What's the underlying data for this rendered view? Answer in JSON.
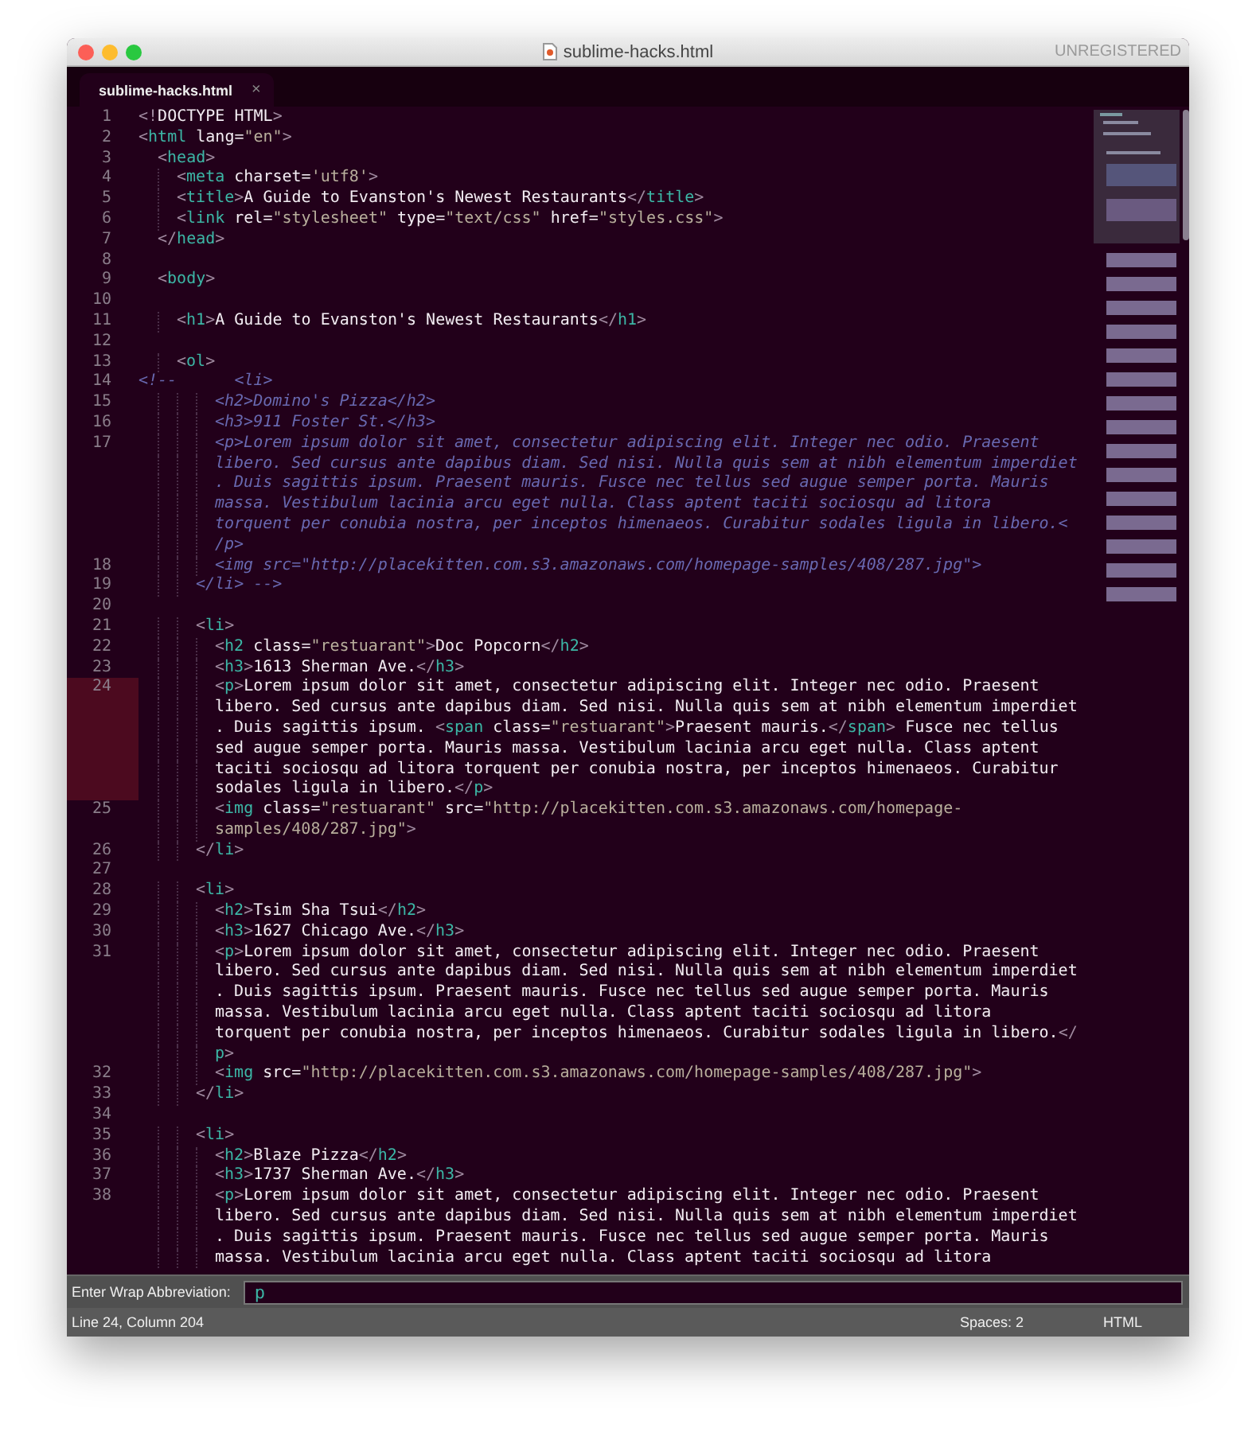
{
  "window": {
    "title": "sublime-hacks.html",
    "badge": "UNREGISTERED"
  },
  "tab": {
    "label": "sublime-hacks.html",
    "close": "×"
  },
  "lines": [
    {
      "number": "1",
      "kind": "code",
      "current": false,
      "rows": [
        "<!DOCTYPE HTML>"
      ]
    },
    {
      "number": "2",
      "kind": "code",
      "current": false,
      "rows": [
        "<html lang=\"en\">"
      ]
    },
    {
      "number": "3",
      "kind": "code",
      "current": false,
      "rows": [
        "  <head>"
      ]
    },
    {
      "number": "4",
      "kind": "code",
      "current": false,
      "rows": [
        "    <meta charset='utf8'>"
      ]
    },
    {
      "number": "5",
      "kind": "code",
      "current": false,
      "rows": [
        "    <title>A Guide to Evanston's Newest Restaurants</title>"
      ]
    },
    {
      "number": "6",
      "kind": "code",
      "current": false,
      "rows": [
        "    <link rel=\"stylesheet\" type=\"text/css\" href=\"styles.css\">"
      ]
    },
    {
      "number": "7",
      "kind": "code",
      "current": false,
      "rows": [
        "  </head>"
      ]
    },
    {
      "number": "8",
      "kind": "blank",
      "current": false
    },
    {
      "number": "9",
      "kind": "code",
      "current": false,
      "rows": [
        "  <body>"
      ]
    },
    {
      "number": "10",
      "kind": "blank",
      "current": false
    },
    {
      "number": "11",
      "kind": "code",
      "current": false,
      "rows": [
        "    <h1>A Guide to Evanston's Newest Restaurants</h1>"
      ]
    },
    {
      "number": "12",
      "kind": "blank",
      "current": false
    },
    {
      "number": "13",
      "kind": "code",
      "current": false,
      "rows": [
        "    <ol>"
      ]
    },
    {
      "number": "14",
      "kind": "comment",
      "current": false,
      "rows": [
        "<!--      <li>"
      ]
    },
    {
      "number": "15",
      "kind": "comment",
      "current": false,
      "rows": [
        "        <h2>Domino's Pizza</h2>"
      ]
    },
    {
      "number": "16",
      "kind": "comment",
      "current": false,
      "rows": [
        "        <h3>911 Foster St.</h3>"
      ]
    },
    {
      "number": "17",
      "kind": "comment",
      "current": false,
      "rows": [
        "        <p>Lorem ipsum dolor sit amet, consectetur adipiscing elit. Integer nec odio. Praesent",
        "libero. Sed cursus ante dapibus diam. Sed nisi. Nulla quis sem at nibh elementum imperdiet",
        ". Duis sagittis ipsum. Praesent mauris. Fusce nec tellus sed augue semper porta. Mauris",
        "massa. Vestibulum lacinia arcu eget nulla. Class aptent taciti sociosqu ad litora",
        "torquent per conubia nostra, per inceptos himenaeos. Curabitur sodales ligula in libero.<",
        "/p>"
      ]
    },
    {
      "number": "18",
      "kind": "comment",
      "current": false,
      "rows": [
        "        <img src=\"http://placekitten.com.s3.amazonaws.com/homepage-samples/408/287.jpg\">"
      ]
    },
    {
      "number": "19",
      "kind": "comment",
      "current": false,
      "rows": [
        "      </li> -->"
      ]
    },
    {
      "number": "20",
      "kind": "blank",
      "current": false
    },
    {
      "number": "21",
      "kind": "code",
      "current": false,
      "rows": [
        "      <li>"
      ]
    },
    {
      "number": "22",
      "kind": "code",
      "current": false,
      "rows": [
        "        <h2 class=\"restuarant\">Doc Popcorn</h2>"
      ]
    },
    {
      "number": "23",
      "kind": "code",
      "current": false,
      "rows": [
        "        <h3>1613 Sherman Ave.</h3>"
      ]
    },
    {
      "number": "24",
      "kind": "code",
      "current": true,
      "rows": [
        "        <p>Lorem ipsum dolor sit amet, consectetur adipiscing elit. Integer nec odio. Praesent",
        "libero. Sed cursus ante dapibus diam. Sed nisi. Nulla quis sem at nibh elementum imperdiet",
        ". Duis sagittis ipsum. <span class=\"restuarant\">Praesent mauris.</span> Fusce nec tellus",
        "sed augue semper porta. Mauris massa. Vestibulum lacinia arcu eget nulla. Class aptent",
        "taciti sociosqu ad litora torquent per conubia nostra, per inceptos himenaeos. Curabitur",
        "sodales ligula in libero.</p>"
      ]
    },
    {
      "number": "25",
      "kind": "code",
      "current": false,
      "rows": [
        "        <img class=\"restuarant\" src=\"http://placekitten.com.s3.amazonaws.com/homepage-",
        "samples/408/287.jpg\">"
      ]
    },
    {
      "number": "26",
      "kind": "code",
      "current": false,
      "rows": [
        "      </li>"
      ]
    },
    {
      "number": "27",
      "kind": "blank",
      "current": false
    },
    {
      "number": "28",
      "kind": "code",
      "current": false,
      "rows": [
        "      <li>"
      ]
    },
    {
      "number": "29",
      "kind": "code",
      "current": false,
      "rows": [
        "        <h2>Tsim Sha Tsui</h2>"
      ]
    },
    {
      "number": "30",
      "kind": "code",
      "current": false,
      "rows": [
        "        <h3>1627 Chicago Ave.</h3>"
      ]
    },
    {
      "number": "31",
      "kind": "code",
      "current": false,
      "rows": [
        "        <p>Lorem ipsum dolor sit amet, consectetur adipiscing elit. Integer nec odio. Praesent",
        "libero. Sed cursus ante dapibus diam. Sed nisi. Nulla quis sem at nibh elementum imperdiet",
        ". Duis sagittis ipsum. Praesent mauris. Fusce nec tellus sed augue semper porta. Mauris",
        "massa. Vestibulum lacinia arcu eget nulla. Class aptent taciti sociosqu ad litora",
        "torquent per conubia nostra, per inceptos himenaeos. Curabitur sodales ligula in libero.</",
        "p>"
      ]
    },
    {
      "number": "32",
      "kind": "code",
      "current": false,
      "rows": [
        "        <img src=\"http://placekitten.com.s3.amazonaws.com/homepage-samples/408/287.jpg\">"
      ]
    },
    {
      "number": "33",
      "kind": "code",
      "current": false,
      "rows": [
        "      </li>"
      ]
    },
    {
      "number": "34",
      "kind": "blank",
      "current": false
    },
    {
      "number": "35",
      "kind": "code",
      "current": false,
      "rows": [
        "      <li>"
      ]
    },
    {
      "number": "36",
      "kind": "code",
      "current": false,
      "rows": [
        "        <h2>Blaze Pizza</h2>"
      ]
    },
    {
      "number": "37",
      "kind": "code",
      "current": false,
      "rows": [
        "        <h3>1737 Sherman Ave.</h3>"
      ]
    },
    {
      "number": "38",
      "kind": "code",
      "current": false,
      "rows": [
        "        <p>Lorem ipsum dolor sit amet, consectetur adipiscing elit. Integer nec odio. Praesent",
        "libero. Sed cursus ante dapibus diam. Sed nisi. Nulla quis sem at nibh elementum imperdiet",
        ". Duis sagittis ipsum. Praesent mauris. Fusce nec tellus sed augue semper porta. Mauris",
        "massa. Vestibulum lacinia arcu eget nulla. Class aptent taciti sociosqu ad litora"
      ]
    }
  ],
  "panel": {
    "label": "Enter Wrap Abbreviation:",
    "value": "p"
  },
  "status_bar": {
    "position": "Line 24, Column 204",
    "indent": "Spaces: 2",
    "syntax": "HTML"
  }
}
